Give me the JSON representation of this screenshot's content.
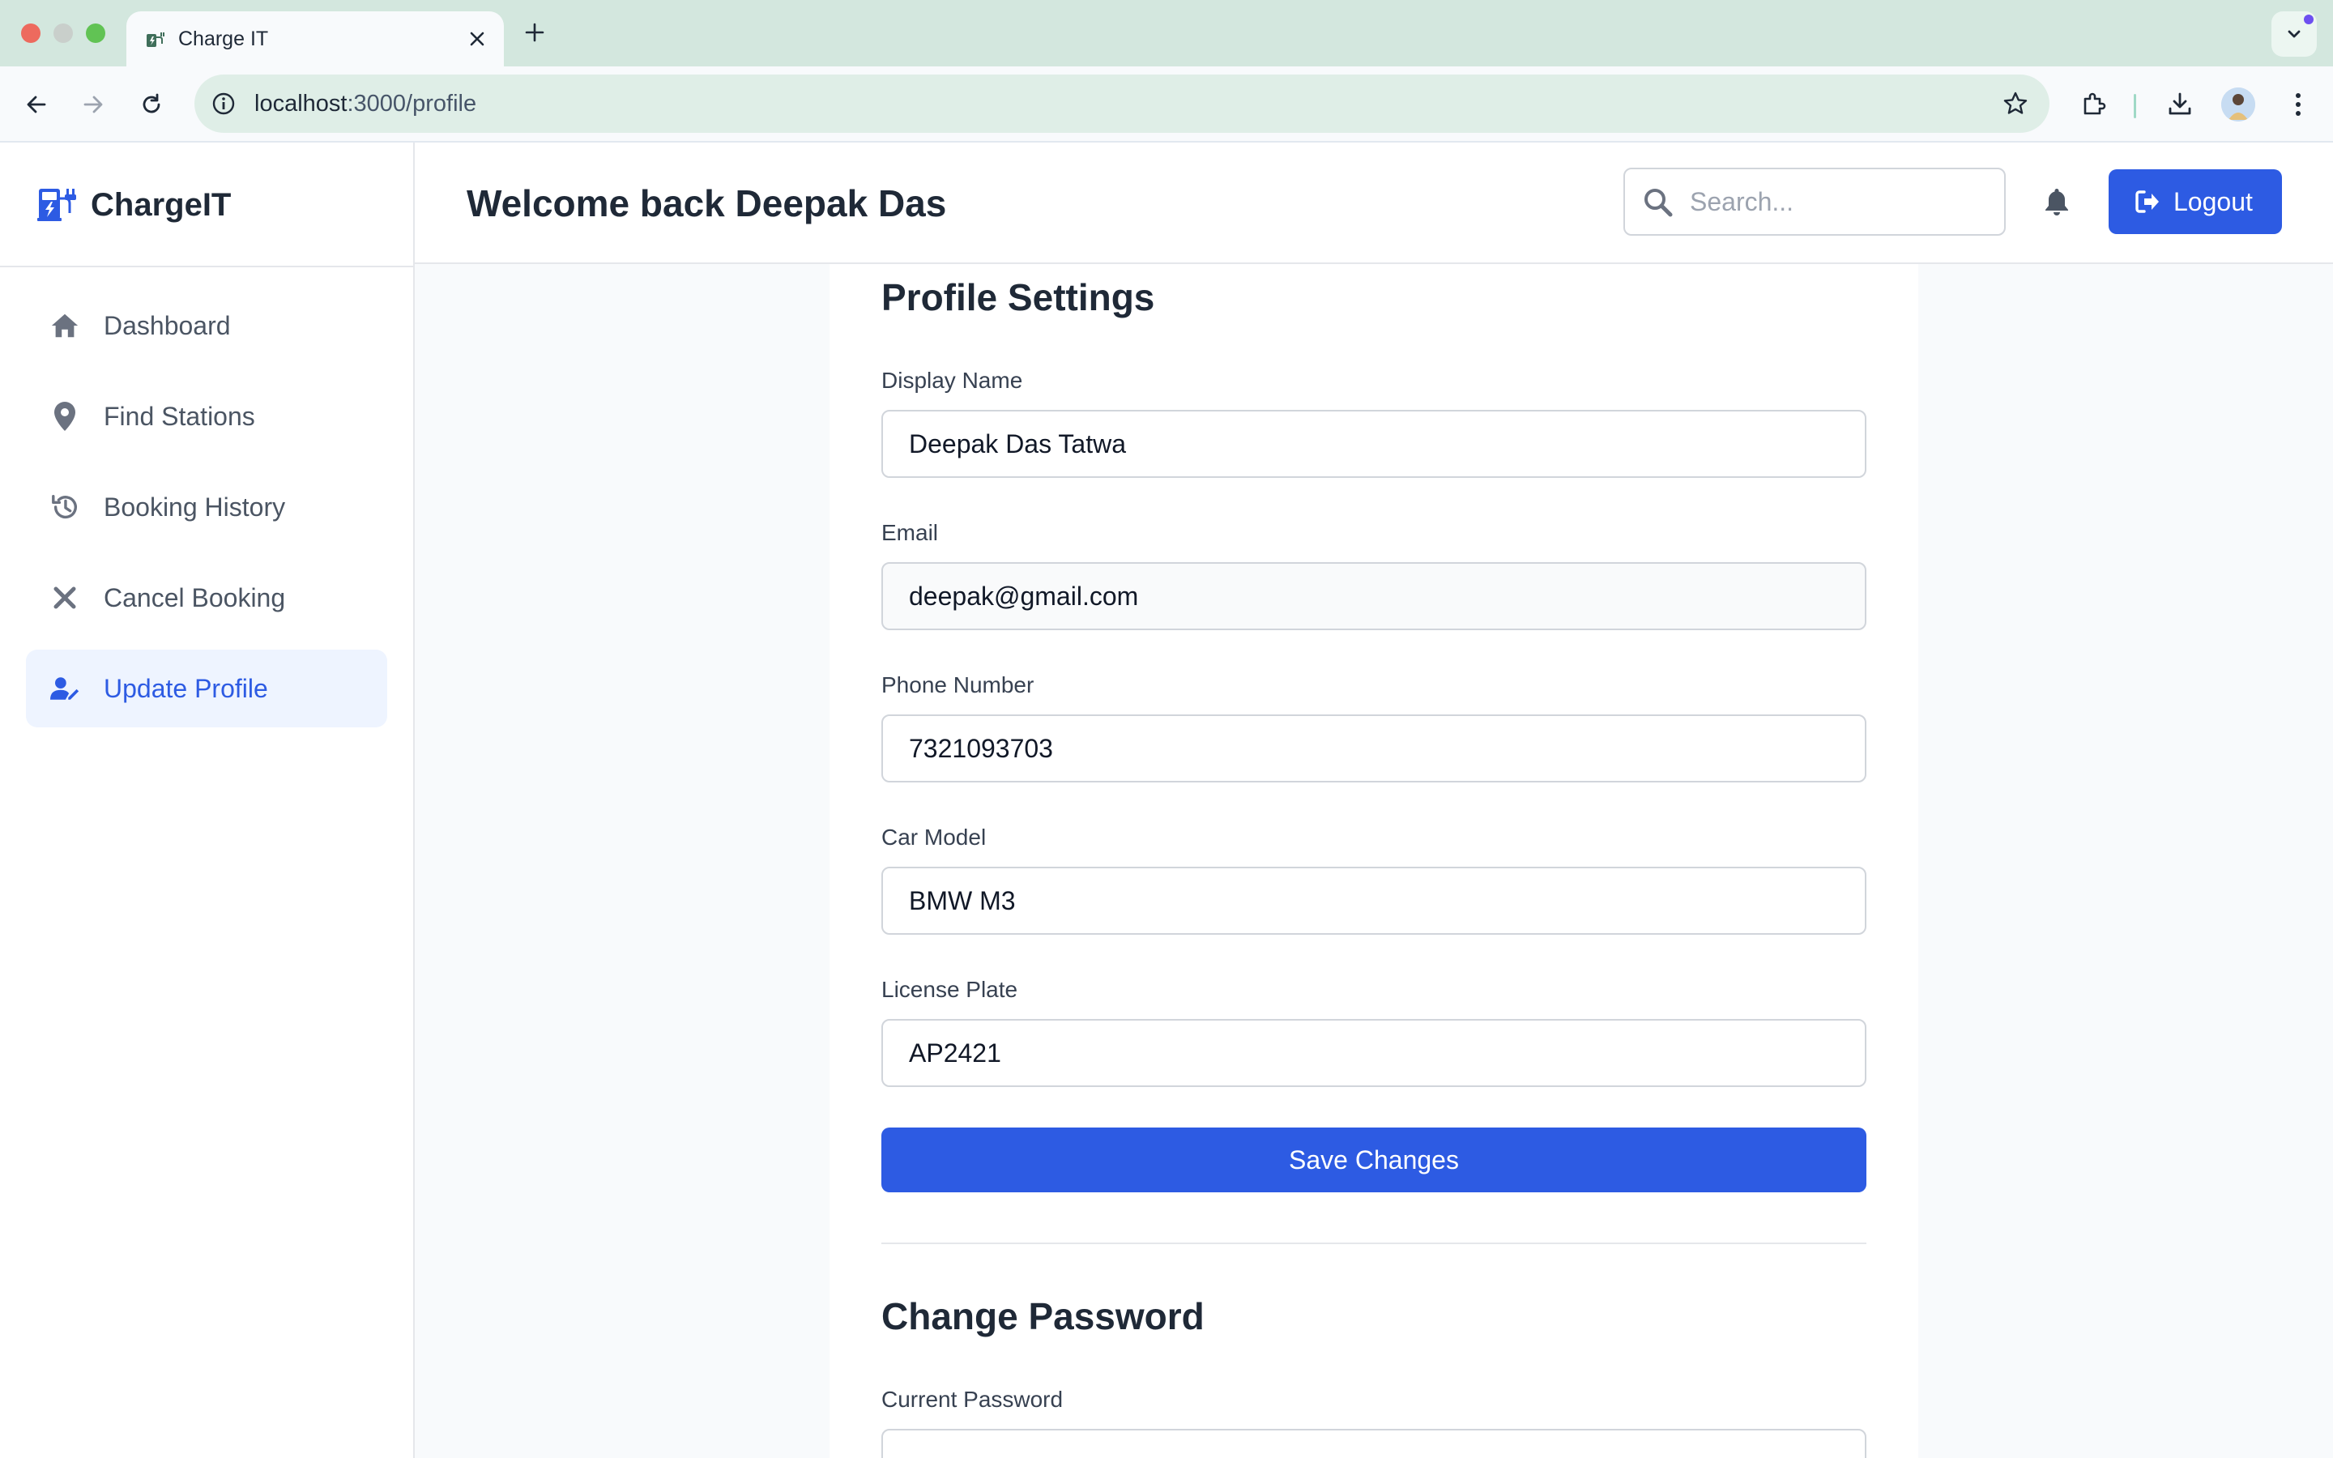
{
  "browser": {
    "tab_title": "Charge IT",
    "url_host": "localhost",
    "url_path": ":3000/profile"
  },
  "brand": {
    "name": "ChargeIT"
  },
  "sidebar": {
    "items": [
      {
        "label": "Dashboard",
        "icon": "home-icon",
        "active": false
      },
      {
        "label": "Find Stations",
        "icon": "map-pin-icon",
        "active": false
      },
      {
        "label": "Booking History",
        "icon": "history-icon",
        "active": false
      },
      {
        "label": "Cancel Booking",
        "icon": "close-icon",
        "active": false
      },
      {
        "label": "Update Profile",
        "icon": "user-edit-icon",
        "active": true
      }
    ]
  },
  "header": {
    "welcome": "Welcome back Deepak Das",
    "search_placeholder": "Search...",
    "logout_label": "Logout"
  },
  "profile": {
    "title": "Profile Settings",
    "display_name_label": "Display Name",
    "display_name_value": "Deepak Das Tatwa",
    "email_label": "Email",
    "email_value": "deepak@gmail.com",
    "phone_label": "Phone Number",
    "phone_value": "7321093703",
    "car_model_label": "Car Model",
    "car_model_value": "BMW M3",
    "license_plate_label": "License Plate",
    "license_plate_value": "AP2421",
    "save_label": "Save Changes"
  },
  "password": {
    "title": "Change Password",
    "current_label": "Current Password"
  },
  "colors": {
    "primary": "#2d5be3",
    "active_bg": "#eef4ff",
    "chrome_bg": "#d3e7de"
  }
}
